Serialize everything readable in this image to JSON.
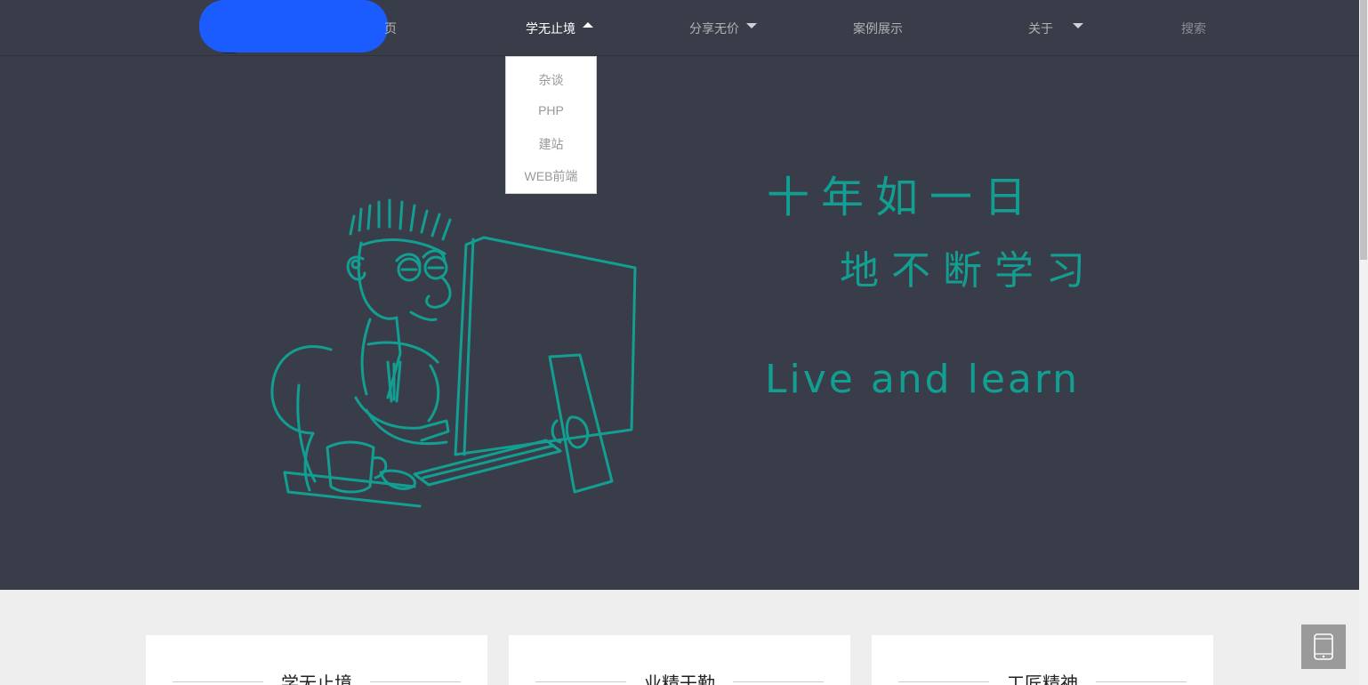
{
  "nav": {
    "home_label": "页",
    "learn_label": "学无止境",
    "share_label": "分享无价",
    "cases_label": "案例展示",
    "about_label": "关于",
    "search_label": "搜索"
  },
  "dropdown": {
    "items": [
      "杂谈",
      "PHP",
      "建站",
      "WEB前端"
    ]
  },
  "hero": {
    "line1": "十年如一日",
    "line2": "地不断学习",
    "line3": "Live and learn"
  },
  "cards": [
    {
      "title": "学无止境"
    },
    {
      "title": "业精于勤"
    },
    {
      "title": "工匠精神"
    }
  ],
  "colors": {
    "nav_bg": "#393d49",
    "accent": "#139e92",
    "logo_blob": "#1b5cff"
  },
  "icons": {
    "dropdown_open": "caret-up-icon",
    "dropdown_closed": "caret-down-icon",
    "mobile": "mobile-icon"
  }
}
